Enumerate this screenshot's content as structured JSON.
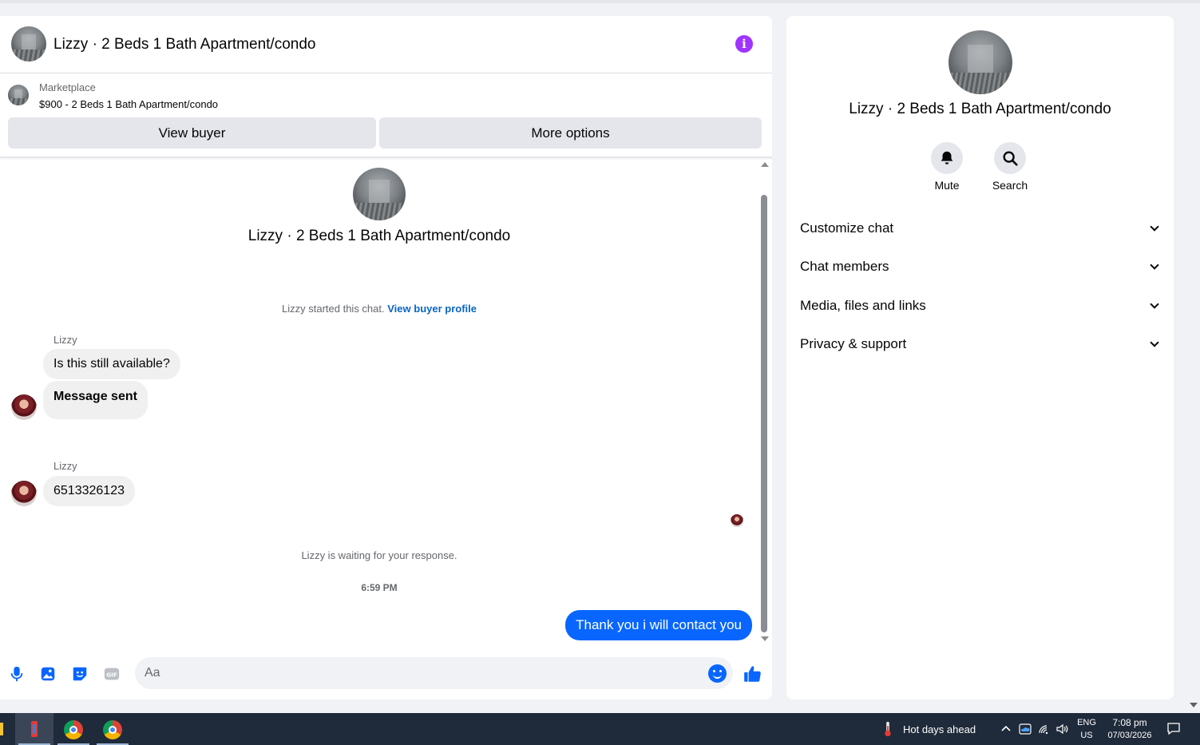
{
  "chat": {
    "title": "Lizzy · 2 Beds 1 Bath Apartment/condo",
    "marketplace_label": "Marketplace",
    "listing": "$900 - 2 Beds 1 Bath Apartment/condo",
    "view_buyer": "View buyer",
    "more_options": "More options",
    "conversation_title": "Lizzy · 2 Beds 1 Bath Apartment/condo",
    "started_text": "Lizzy started this chat.",
    "view_profile_link": "View buyer profile",
    "messages": [
      {
        "sender": "Lizzy",
        "text": "Is this still available?"
      },
      {
        "text": "Message sent"
      },
      {
        "sender": "Lizzy",
        "text": "6513326123"
      }
    ],
    "waiting_text": "Lizzy is waiting for your response.",
    "timestamp": "6:59 PM",
    "outgoing_message": "Thank you i will contact you",
    "composer_placeholder": "Aa",
    "accent_color": "#0866ff"
  },
  "sidebar": {
    "title": "Lizzy · 2 Beds 1 Bath Apartment/condo",
    "actions": [
      {
        "label": "Mute",
        "icon": "bell-icon"
      },
      {
        "label": "Search",
        "icon": "search-icon"
      }
    ],
    "sections": [
      "Customize chat",
      "Chat members",
      "Media, files and links",
      "Privacy & support"
    ]
  },
  "taskbar": {
    "weather": "Hot days ahead",
    "language": "ENG",
    "region": "US",
    "time": "7:08 pm",
    "date": "07/03/2026"
  }
}
